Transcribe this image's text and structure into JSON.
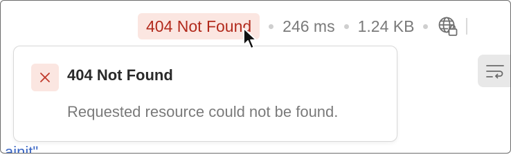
{
  "response_bar": {
    "status_label": "404 Not Found",
    "time": "246 ms",
    "size": "1.24 KB"
  },
  "error_popover": {
    "title": "404 Not Found",
    "message": "Requested resource could not be found."
  },
  "background": {
    "partial_text": "ainit\""
  },
  "icons": {
    "globe": "globe-lock-icon",
    "close": "close-x-icon",
    "wrap": "text-wrap-icon",
    "cursor": "mouse-pointer-icon"
  },
  "colors": {
    "error_bg": "#fbe6e1",
    "error_text": "#b22a1c",
    "meta_text": "#7a7a7a"
  }
}
